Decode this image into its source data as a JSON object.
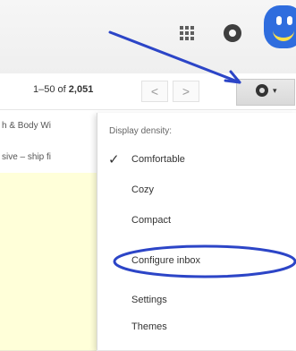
{
  "header": {
    "apps_icon": "apps-grid-icon",
    "notifications_icon": "circle-icon",
    "avatar_icon": "smiley-avatar"
  },
  "toolbar": {
    "range": "1–50",
    "of_label": "of",
    "total": "2,051",
    "prev_label": "<",
    "next_label": ">",
    "settings_icon": "gear-icon",
    "settings_caret": "▾"
  },
  "message_list": {
    "rows": [
      {
        "snippet": "h & Body Wi"
      },
      {
        "snippet": "sive – ship fi"
      },
      {
        "snippet": ""
      },
      {
        "snippet": ""
      },
      {
        "snippet": ""
      },
      {
        "snippet": ""
      },
      {
        "snippet": ""
      }
    ]
  },
  "settings_menu": {
    "heading": "Display density:",
    "density_options": [
      {
        "label": "Comfortable",
        "checked": true
      },
      {
        "label": "Cozy",
        "checked": false
      },
      {
        "label": "Compact",
        "checked": false
      }
    ],
    "configure_label": "Configure inbox",
    "settings_label": "Settings",
    "themes_label": "Themes",
    "check_glyph": "✓"
  },
  "colors": {
    "annotation_blue": "#2c45c7",
    "row_highlight": "#ffffd9"
  }
}
